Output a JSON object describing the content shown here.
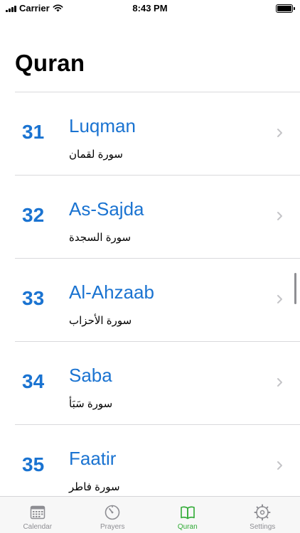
{
  "status_bar": {
    "carrier": "Carrier",
    "time": "8:43 PM"
  },
  "page": {
    "title": "Quran"
  },
  "surahs": [
    {
      "number": "31",
      "name": "Luqman",
      "arabic": "سورة لقمان"
    },
    {
      "number": "32",
      "name": "As-Sajda",
      "arabic": "سورة السجدة"
    },
    {
      "number": "33",
      "name": "Al-Ahzaab",
      "arabic": "سورة الأحزاب"
    },
    {
      "number": "34",
      "name": "Saba",
      "arabic": "سورة سَبَأ"
    },
    {
      "number": "35",
      "name": "Faatir",
      "arabic": "سورة فاطر"
    }
  ],
  "tab_bar": {
    "tabs": [
      {
        "label": "Calendar",
        "icon": "calendar-icon",
        "active": false
      },
      {
        "label": "Prayers",
        "icon": "clock-icon",
        "active": false
      },
      {
        "label": "Quran",
        "icon": "book-icon",
        "active": true
      },
      {
        "label": "Settings",
        "icon": "gear-icon",
        "active": false
      }
    ]
  },
  "colors": {
    "accent": "#1a73d1",
    "active_tab": "#2faa34",
    "inactive_tab": "#8e8e93"
  }
}
